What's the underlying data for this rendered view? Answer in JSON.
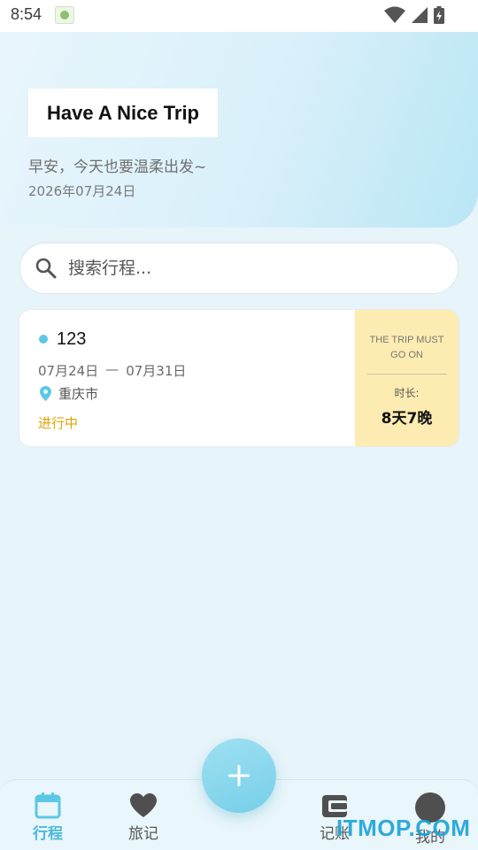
{
  "status_bar": {
    "time": "8:54"
  },
  "hero": {
    "title": "Have A Nice Trip",
    "greeting": "早安，今天也要温柔出发~",
    "date": "2026年07月24日"
  },
  "search": {
    "placeholder": "搜索行程..."
  },
  "trips": [
    {
      "name": "123",
      "start_date": "07月24日",
      "separator": "—",
      "end_date": "07月31日",
      "location": "重庆市",
      "status": "进行中",
      "slogan": "THE TRIP MUST GO ON",
      "duration_label": "时长:",
      "duration": "8天7晚"
    }
  ],
  "bottom_nav": {
    "items": [
      {
        "label": "行程",
        "icon": "calendar-icon",
        "active": true
      },
      {
        "label": "旅记",
        "icon": "heart-icon",
        "active": false
      },
      {
        "label": "记账",
        "icon": "wallet-icon",
        "active": false
      },
      {
        "label": "我的",
        "icon": "avatar-icon",
        "active": false
      }
    ]
  },
  "fab": {
    "icon": "plus-icon"
  },
  "watermark": {
    "text": "ITMOP.COM"
  },
  "colors": {
    "accent": "#49b9dc",
    "status_in_progress": "#e0a400",
    "trip_side_bg": "#fdecb2"
  }
}
